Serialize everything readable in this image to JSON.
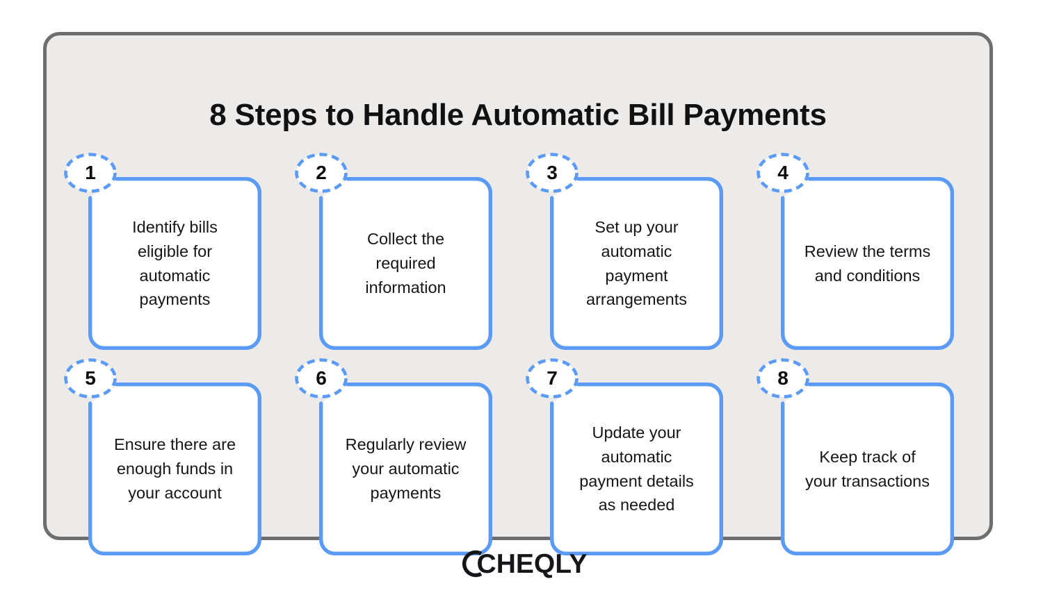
{
  "header": {
    "title": "8 Steps to Handle Automatic Bill Payments"
  },
  "colors": {
    "accent_blue": "#5b9bf5",
    "frame_border": "#6e6e6e",
    "frame_background": "#edebe9",
    "card_background": "#ffffff",
    "text": "#15161a",
    "page_background": "#ffffff"
  },
  "steps": [
    {
      "number": "1",
      "text": "Identify bills eligible for automatic payments"
    },
    {
      "number": "2",
      "text": "Collect the required information"
    },
    {
      "number": "3",
      "text": "Set up your automatic payment arrangements"
    },
    {
      "number": "4",
      "text": "Review the terms and conditions"
    },
    {
      "number": "5",
      "text": "Ensure there are enough funds in your account"
    },
    {
      "number": "6",
      "text": "Regularly review your automatic payments"
    },
    {
      "number": "7",
      "text": "Update your automatic payment details as needed"
    },
    {
      "number": "8",
      "text": "Keep track of your transactions"
    }
  ],
  "footer": {
    "logo_mark": "cheqly-c-ring-icon",
    "logo_text": "CHEQLY"
  }
}
